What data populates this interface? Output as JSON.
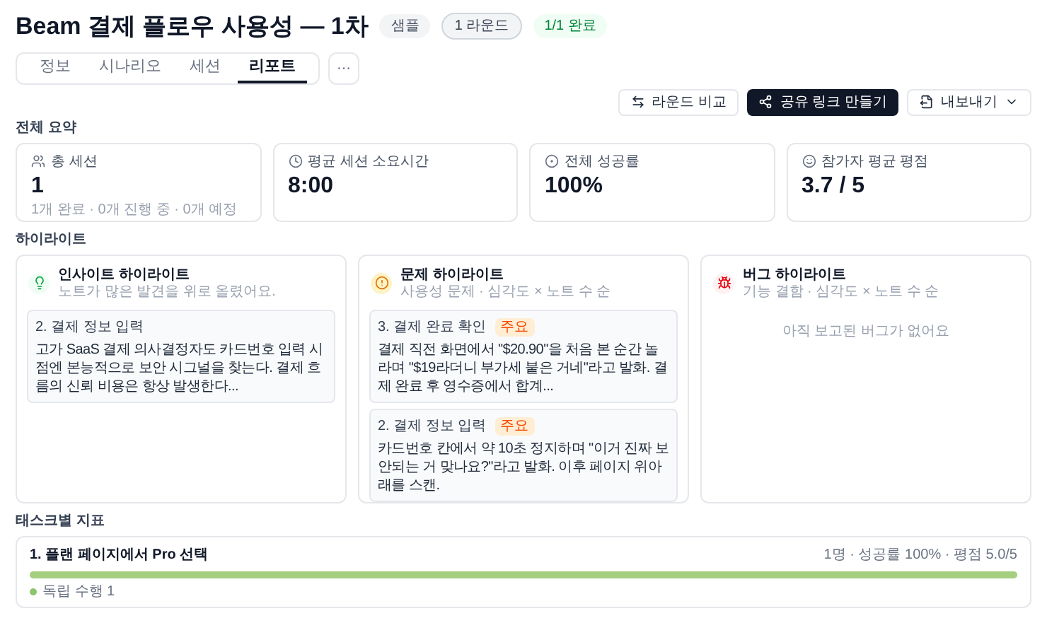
{
  "header": {
    "title": "Beam 결제 플로우 사용성 — 1차",
    "badges": [
      {
        "label": "샘플",
        "kind": "neutral"
      },
      {
        "label": "1 라운드",
        "kind": "outline"
      },
      {
        "label": "1/1 완료",
        "kind": "success"
      }
    ]
  },
  "tabs": [
    {
      "label": "정보",
      "selected": false
    },
    {
      "label": "시나리오",
      "selected": false
    },
    {
      "label": "세션",
      "selected": false
    },
    {
      "label": "리포트",
      "selected": true
    }
  ],
  "more_button": "···",
  "actions": [
    {
      "label": "라운드 비교",
      "kind": "compare"
    },
    {
      "label": "공유 링크 만들기",
      "kind": "share"
    },
    {
      "label": "내보내기",
      "kind": "export"
    }
  ],
  "summary": {
    "title": "전체 요약",
    "cards": [
      {
        "kind": "users",
        "label": "총 세션",
        "value": "1",
        "note": "1개 완료 · 0개 진행 중 · 0개 예정"
      },
      {
        "kind": "clock",
        "label": "평균 세션 소요시간",
        "value": "8:00"
      },
      {
        "kind": "target",
        "label": "전체 성공률",
        "value": "100%"
      },
      {
        "kind": "smile",
        "label": "참가자 평균 평점",
        "value": "3.7 / 5"
      }
    ]
  },
  "highlights": {
    "title": "하이라이트",
    "panels": [
      {
        "kind": "insight",
        "title": "인사이트 하이라이트",
        "subtitle": "노트가 많은 발견을 위로 올렸어요.",
        "items": [
          {
            "task": "2. 결제 정보 입력",
            "text": "고가 SaaS 결제 의사결정자도 카드번호 입력 시점엔 본능적으로 보안 시그널을 찾는다. 결제 흐름의 신뢰 비용은 항상 발생한다..."
          }
        ]
      },
      {
        "kind": "problem",
        "title": "문제 하이라이트",
        "subtitle": "사용성 문제 · 심각도 × 노트 수 순",
        "items": [
          {
            "task": "3. 결제 완료 확인",
            "tag": "주요",
            "text": "결제 직전 화면에서 \"$20.90\"을 처음 본 순간 놀라며 \"$19라더니 부가세 붙은 거네\"라고 발화. 결제 완료 후 영수증에서 합계..."
          },
          {
            "task": "2. 결제 정보 입력",
            "tag": "주요",
            "text": "카드번호 칸에서 약 10초 정지하며 \"이거 진짜 보안되는 거 맞나요?\"라고 발화. 이후 페이지 위아래를 스캔."
          }
        ]
      },
      {
        "kind": "bug",
        "title": "버그 하이라이트",
        "subtitle": "기능 결함 · 심각도 × 노트 수 순",
        "empty": "아직 보고된 버그가 없어요"
      }
    ]
  },
  "tasks": {
    "title": "태스크별 지표",
    "items": [
      {
        "name": "1. 플랜 페이지에서 Pro 선택",
        "stats": "1명 · 성공률 100% · 평점 5.0/5",
        "level": 1,
        "legend": [
          {
            "label": "독립 수행 1",
            "color": "#8cc56b"
          }
        ]
      }
    ]
  }
}
